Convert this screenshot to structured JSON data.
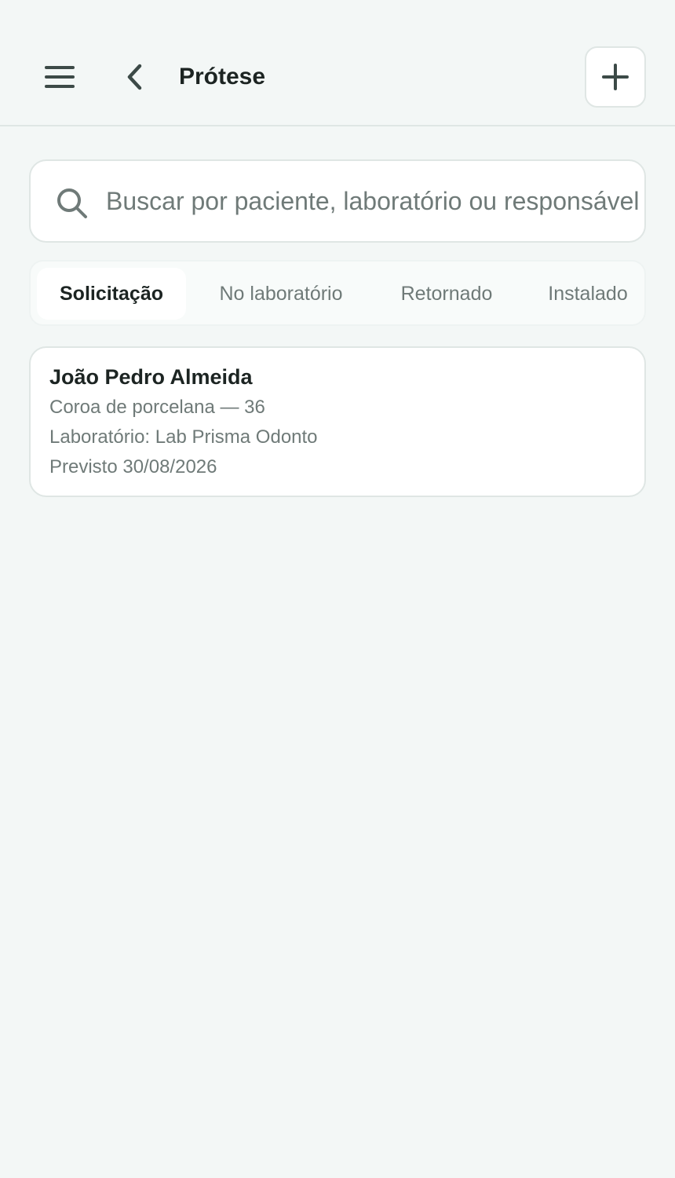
{
  "header": {
    "title": "Prótese",
    "menu_icon": "hamburger-menu-icon",
    "back_icon": "chevron-left-icon",
    "add_icon": "plus-icon"
  },
  "search": {
    "placeholder": "Buscar por paciente, laboratório ou responsável",
    "value": ""
  },
  "tabs": [
    {
      "label": "Solicitação",
      "active": true
    },
    {
      "label": "No laboratório",
      "active": false
    },
    {
      "label": "Retornado",
      "active": false
    },
    {
      "label": "Instalado",
      "active": false
    }
  ],
  "cards": [
    {
      "patient": "João Pedro Almeida",
      "procedure": "Coroa de porcelana — 36",
      "lab": "Laboratório: Lab Prisma Odonto",
      "due": "Previsto 30/08/2026"
    }
  ],
  "colors": {
    "background": "#f3f7f6",
    "surface": "#ffffff",
    "border": "#dfe6e4",
    "text": "#1c2422",
    "muted": "#6f7a78"
  }
}
